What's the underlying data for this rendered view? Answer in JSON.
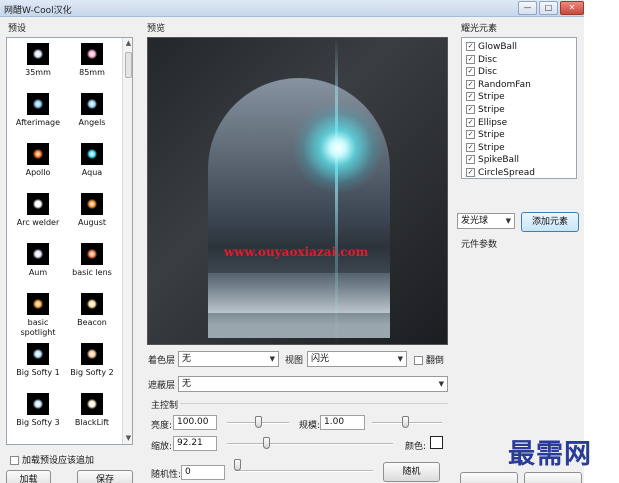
{
  "window": {
    "title": "网醋W-Cool汉化",
    "min": "—",
    "max": "□",
    "close": "✕"
  },
  "presets": {
    "label": "预设",
    "items": [
      {
        "name": "35mm",
        "color": "#dfeaff"
      },
      {
        "name": "85mm",
        "color": "#ffb3d4"
      },
      {
        "name": "Afterimage",
        "color": "#8fd0ff"
      },
      {
        "name": "Angels",
        "color": "#9fd9ff"
      },
      {
        "name": "Apollo",
        "color": "#ff7b2e"
      },
      {
        "name": "Aqua",
        "color": "#4fe1ff"
      },
      {
        "name": "Arc welder",
        "color": "#ffffff"
      },
      {
        "name": "August",
        "color": "#ff9a3c"
      },
      {
        "name": "Aum",
        "color": "#e8e8ff"
      },
      {
        "name": "basic lens",
        "color": "#ff8c5a"
      },
      {
        "name": "basic spotlight",
        "color": "#ffb14a"
      },
      {
        "name": "Beacon",
        "color": "#ffe3a8"
      },
      {
        "name": "Big Softy 1",
        "color": "#b9eaff"
      },
      {
        "name": "Big Softy 2",
        "color": "#ffd0a0"
      },
      {
        "name": "Big Softy 3",
        "color": "#cde9ff"
      },
      {
        "name": "BlackLift",
        "color": "#fff4d8"
      }
    ],
    "add_to_existing": "加载预设应该追加",
    "load_button": "加载",
    "save_button": "保存"
  },
  "preview": {
    "label": "预览",
    "watermark": "www.ouyaoxiazai.com"
  },
  "controls": {
    "color_layer_label": "着色层",
    "color_layer_value": "无",
    "view_label": "视图",
    "view_value": "闪光",
    "flip_label": "翻倒",
    "mask_label": "遮蔽层",
    "mask_value": "无",
    "main_control_label": "主控制",
    "brightness_label": "亮度:",
    "brightness_value": "100.00",
    "scale_label": "规模:",
    "scale_value": "1.00",
    "zoom_label": "缩放:",
    "zoom_value": "92.21",
    "color_label": "颜色:",
    "random_label": "随机性:",
    "random_value": "0",
    "random_button": "随机"
  },
  "elements": {
    "label": "耀光元素",
    "items": [
      "GlowBall",
      "Disc",
      "Disc",
      "RandomFan",
      "Stripe",
      "Stripe",
      "Ellipse",
      "Stripe",
      "Stripe",
      "SpikeBall",
      "CircleSpread"
    ],
    "type_value": "发光球",
    "add_button": "添加元素",
    "params_label": "元件参数"
  },
  "brand": "最需网"
}
